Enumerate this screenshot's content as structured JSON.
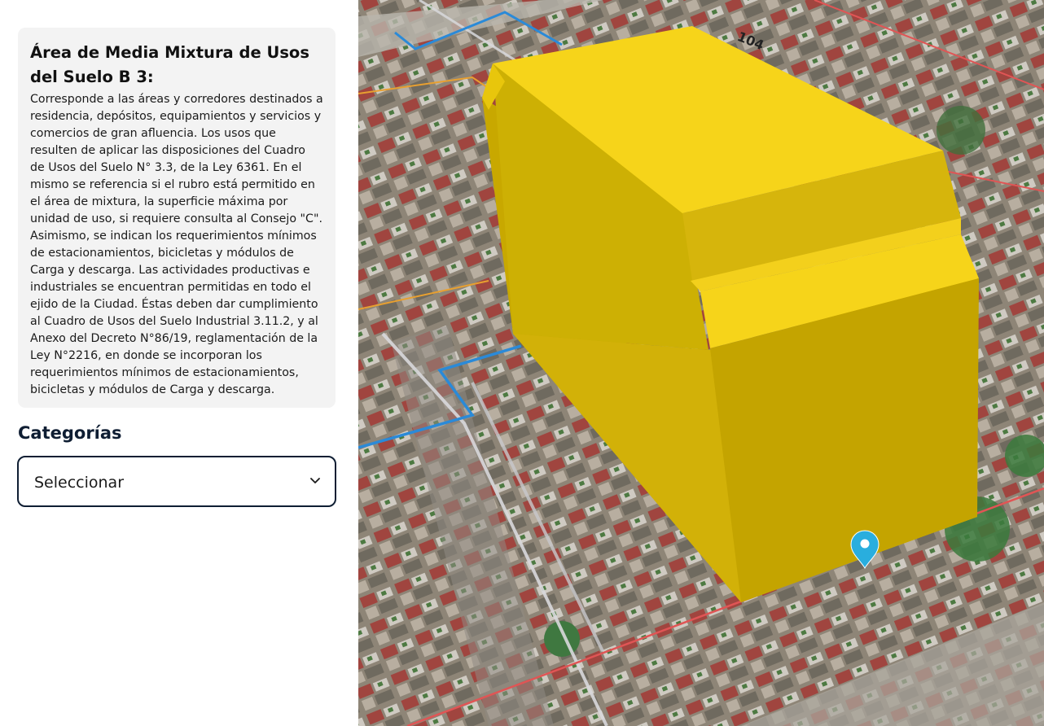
{
  "info": {
    "title": "Área de Media Mixtura de Usos del Suelo B 3:",
    "description": "Corresponde a las áreas y corredores destinados a residencia, depósitos, equipamientos y servicios y comercios de gran afluencia. Los usos que resulten de aplicar las disposiciones del Cuadro de Usos del Suelo N° 3.3, de la Ley 6361. En el mismo se referencia si el rubro está permitido en el área de mixtura, la superficie máxima por unidad de uso, si requiere consulta al Consejo \"C\". Asimismo, se indican los requerimientos mínimos de estacionamientos, bicicletas y módulos de Carga y descarga. Las actividades productivas e industriales se encuentran permitidas en todo el ejido de la Ciudad. Éstas deben dar cumplimiento al Cuadro de Usos del Suelo Industrial 3.11.2, y al Anexo del Decreto N°86/19, reglamentación de la Ley N°2216, en donde se incorporan los requerimientos mínimos de estacionamientos, bicicletas y módulos de Carga y descarga."
  },
  "categories": {
    "label": "Categorías",
    "selected": "Seleccionar"
  },
  "map": {
    "street_label": "104",
    "colors": {
      "volume": "#e8c60c",
      "volume_top": "#f6d41a",
      "parcel_line": "#e05555",
      "zone_line_blue": "#2a8ad8",
      "zone_line_orange": "#e8a030",
      "marker": "#29aede"
    },
    "icons": [
      "location-pin-icon",
      "chevron-down-icon"
    ]
  }
}
